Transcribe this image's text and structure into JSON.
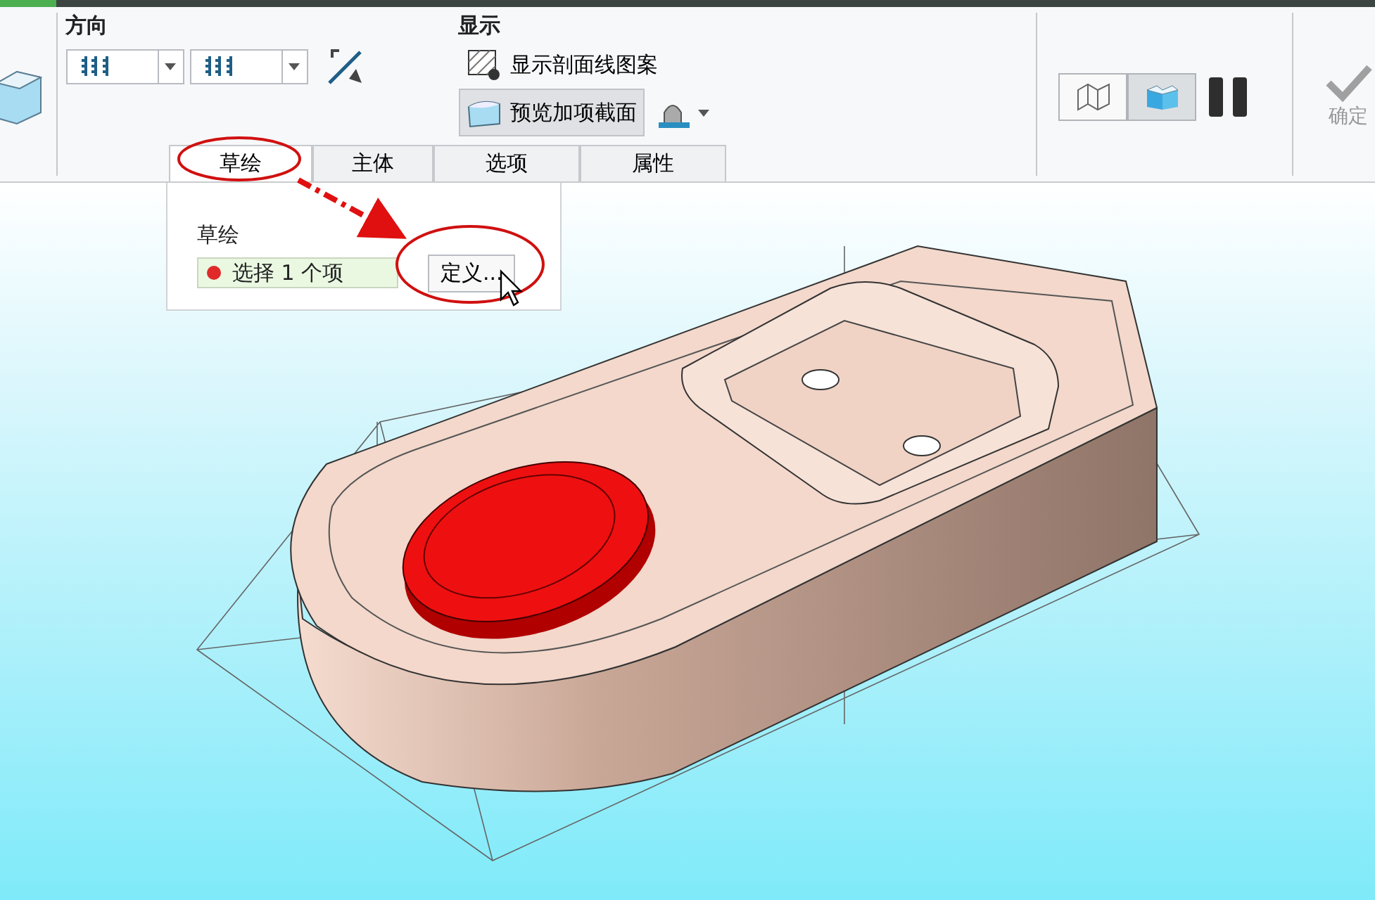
{
  "ribbon": {
    "direction_group": {
      "title": "方向"
    },
    "display_group": {
      "title": "显示",
      "hatch_toggle": {
        "label": "显示剖面线图案",
        "selected": false
      },
      "preview_toggle": {
        "label": "预览加项截面",
        "selected": true
      }
    },
    "view_mode_buttons": [
      {
        "kind": "wireframe",
        "selected": false
      },
      {
        "kind": "shaded",
        "selected": true
      }
    ],
    "ok_button": {
      "label": "确定",
      "disabled": true
    }
  },
  "tabs": [
    {
      "label": "草绘",
      "selected": true
    },
    {
      "label": "主体",
      "selected": false
    },
    {
      "label": "选项",
      "selected": false
    },
    {
      "label": "属性",
      "selected": false
    }
  ],
  "sketch_panel": {
    "title": "草绘",
    "collector": {
      "text": "选择 1 个项"
    },
    "define_button": {
      "label": "定义..."
    }
  }
}
